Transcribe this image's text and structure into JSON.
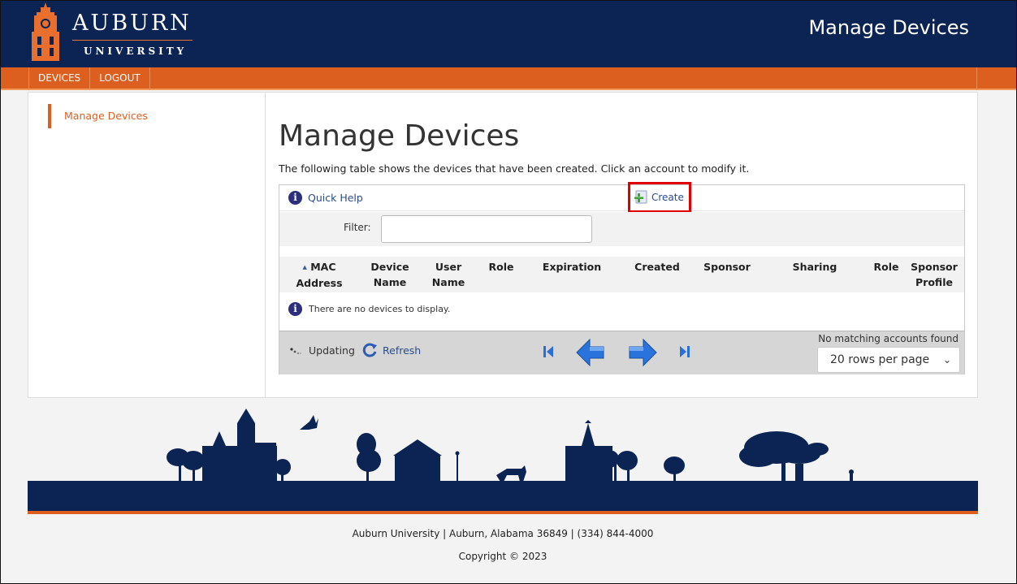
{
  "header": {
    "logo_word": "AUBURN",
    "logo_sub": "UNIVERSITY",
    "title": "Manage Devices"
  },
  "nav": {
    "items": [
      "DEVICES",
      "LOGOUT"
    ]
  },
  "sidebar": {
    "link": "Manage Devices"
  },
  "main": {
    "title": "Manage Devices",
    "description": "The following table shows the devices that have been created. Click an account to modify it.",
    "quick_help": "Quick Help",
    "create": "Create",
    "filter_label": "Filter:",
    "filter_value": "",
    "columns": {
      "mac": [
        "MAC",
        "Address"
      ],
      "device": [
        "Device",
        "Name"
      ],
      "user": [
        "User",
        "Name"
      ],
      "role": "Role",
      "expiration": "Expiration",
      "created": "Created",
      "sponsor": "Sponsor",
      "sharing": "Sharing",
      "role2": "Role",
      "sponsor_profile": [
        "Sponsor",
        "Profile"
      ]
    },
    "empty_message": "There are no devices to display.",
    "status": "Updating",
    "refresh": "Refresh",
    "no_match": "No matching accounts found",
    "rows_per_page": "20 rows per page"
  },
  "footer": {
    "address": "Auburn University | Auburn, Alabama 36849 | (334) 844-4000",
    "copyright": "Copyright © 2023"
  },
  "colors": {
    "navy": "#0c2454",
    "orange": "#dd5f20",
    "link": "#2a4c8a",
    "highlight": "#e00000"
  },
  "icons": [
    "clock-tower-logo-icon",
    "info-icon",
    "create-plus-icon",
    "loading-spinner-icon",
    "refresh-icon",
    "first-page-icon",
    "previous-page-icon",
    "next-page-icon",
    "last-page-icon",
    "chevron-down-icon"
  ]
}
